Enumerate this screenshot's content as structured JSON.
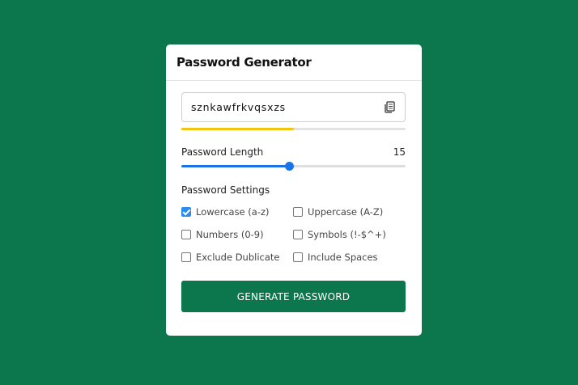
{
  "app": {
    "title": "Password Generator"
  },
  "password": {
    "value": "sznkawfrkvqsxzs",
    "strength_fraction": 0.5,
    "strength_color": "#f1c40f"
  },
  "length": {
    "label": "Password Length",
    "value": "15",
    "slider_fraction": 0.48
  },
  "settings": {
    "title": "Password Settings",
    "options": [
      {
        "label": "Lowercase (a-z)",
        "checked": true
      },
      {
        "label": "Uppercase (A-Z)",
        "checked": false
      },
      {
        "label": "Numbers (0-9)",
        "checked": false
      },
      {
        "label": "Symbols (!-$^+)",
        "checked": false
      },
      {
        "label": "Exclude Dublicate",
        "checked": false
      },
      {
        "label": "Include Spaces",
        "checked": false
      }
    ]
  },
  "button": {
    "label": "GENERATE PASSWORD"
  },
  "colors": {
    "background": "#0c774d",
    "accent": "#1a73e8",
    "button": "#0c774d"
  },
  "icons": {
    "copy": "copy-icon"
  }
}
